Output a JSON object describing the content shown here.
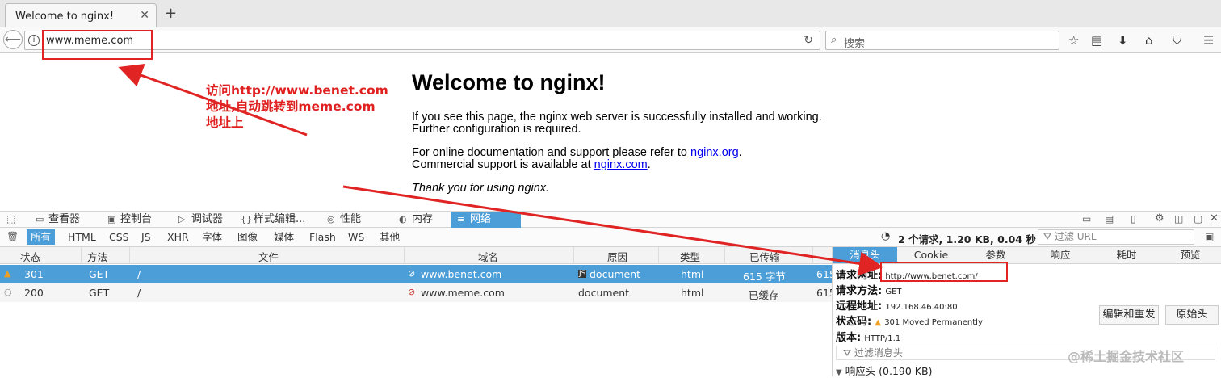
{
  "browser": {
    "tab_title": "Welcome to nginx!",
    "close_glyph": "✕",
    "new_tab_glyph": "+",
    "url": "www.meme.com",
    "search_placeholder": "搜索"
  },
  "page": {
    "heading": "Welcome to nginx!",
    "para1_line1": "If you see this page, the nginx web server is successfully installed and working.",
    "para1_line2": "Further configuration is required.",
    "para2_line1_pre": "For online documentation and support please refer to ",
    "para2_link1": "nginx.org",
    "para2_line1_post": ".",
    "para2_line2_pre": "Commercial support is available at ",
    "para2_link2": "nginx.com",
    "para2_line2_post": ".",
    "thanks": "Thank you for using nginx."
  },
  "annotation": {
    "line1": "访问http://www.benet.com",
    "line2": "地址,自动跳转到meme.com",
    "line3": "地址上",
    "color": "#e02020"
  },
  "devtools": {
    "tabs": [
      {
        "label": "查看器",
        "icon": "inspector-icon"
      },
      {
        "label": "控制台",
        "icon": "console-icon"
      },
      {
        "label": "调试器",
        "icon": "debugger-icon"
      },
      {
        "label": "样式编辑...",
        "icon": "style-editor-icon"
      },
      {
        "label": "性能",
        "icon": "performance-icon"
      },
      {
        "label": "内存",
        "icon": "memory-icon"
      },
      {
        "label": "网络",
        "icon": "network-icon"
      }
    ],
    "selected_tab": "网络",
    "filters": [
      "所有",
      "HTML",
      "CSS",
      "JS",
      "XHR",
      "字体",
      "图像",
      "媒体",
      "Flash",
      "WS",
      "其他"
    ],
    "selected_filter": "所有",
    "summary": "2 个请求, 1.20 KB, 0.04 秒",
    "filter_url_placeholder": "过滤 URL",
    "columns": [
      "状态",
      "方法",
      "文件",
      "域名",
      "原因",
      "类型",
      "已传输"
    ],
    "requests": [
      {
        "status": "301",
        "method": "GET",
        "file": "/",
        "domain": "www.benet.com",
        "cause": "document",
        "type": "html",
        "transferred": "615 字节",
        "size": "615"
      },
      {
        "status": "200",
        "method": "GET",
        "file": "/",
        "domain": "www.meme.com",
        "cause": "document",
        "type": "html",
        "transferred": "已缓存",
        "size": "615"
      }
    ],
    "selected_row": 0,
    "accent": "#4c9ed9"
  },
  "details": {
    "tabs": [
      "消息头",
      "Cookie",
      "参数",
      "响应",
      "耗时",
      "预览"
    ],
    "selected_tab": "消息头",
    "url_label": "请求网址:",
    "url_value": "http://www.benet.com/",
    "method_label": "请求方法:",
    "method_value": "GET",
    "remote_label": "远程地址:",
    "remote_value": "192.168.46.40:80",
    "status_label": "状态码:",
    "status_value": "301  Moved  Permanently",
    "version_label": "版本:",
    "version_value": "HTTP/1.1",
    "edit_resend": "编辑和重发",
    "raw_headers": "原始头",
    "filter_headers_placeholder": "过滤消息头",
    "response_headers": "响应头 (0.190 KB)"
  },
  "watermark": "@稀土掘金技术社区"
}
